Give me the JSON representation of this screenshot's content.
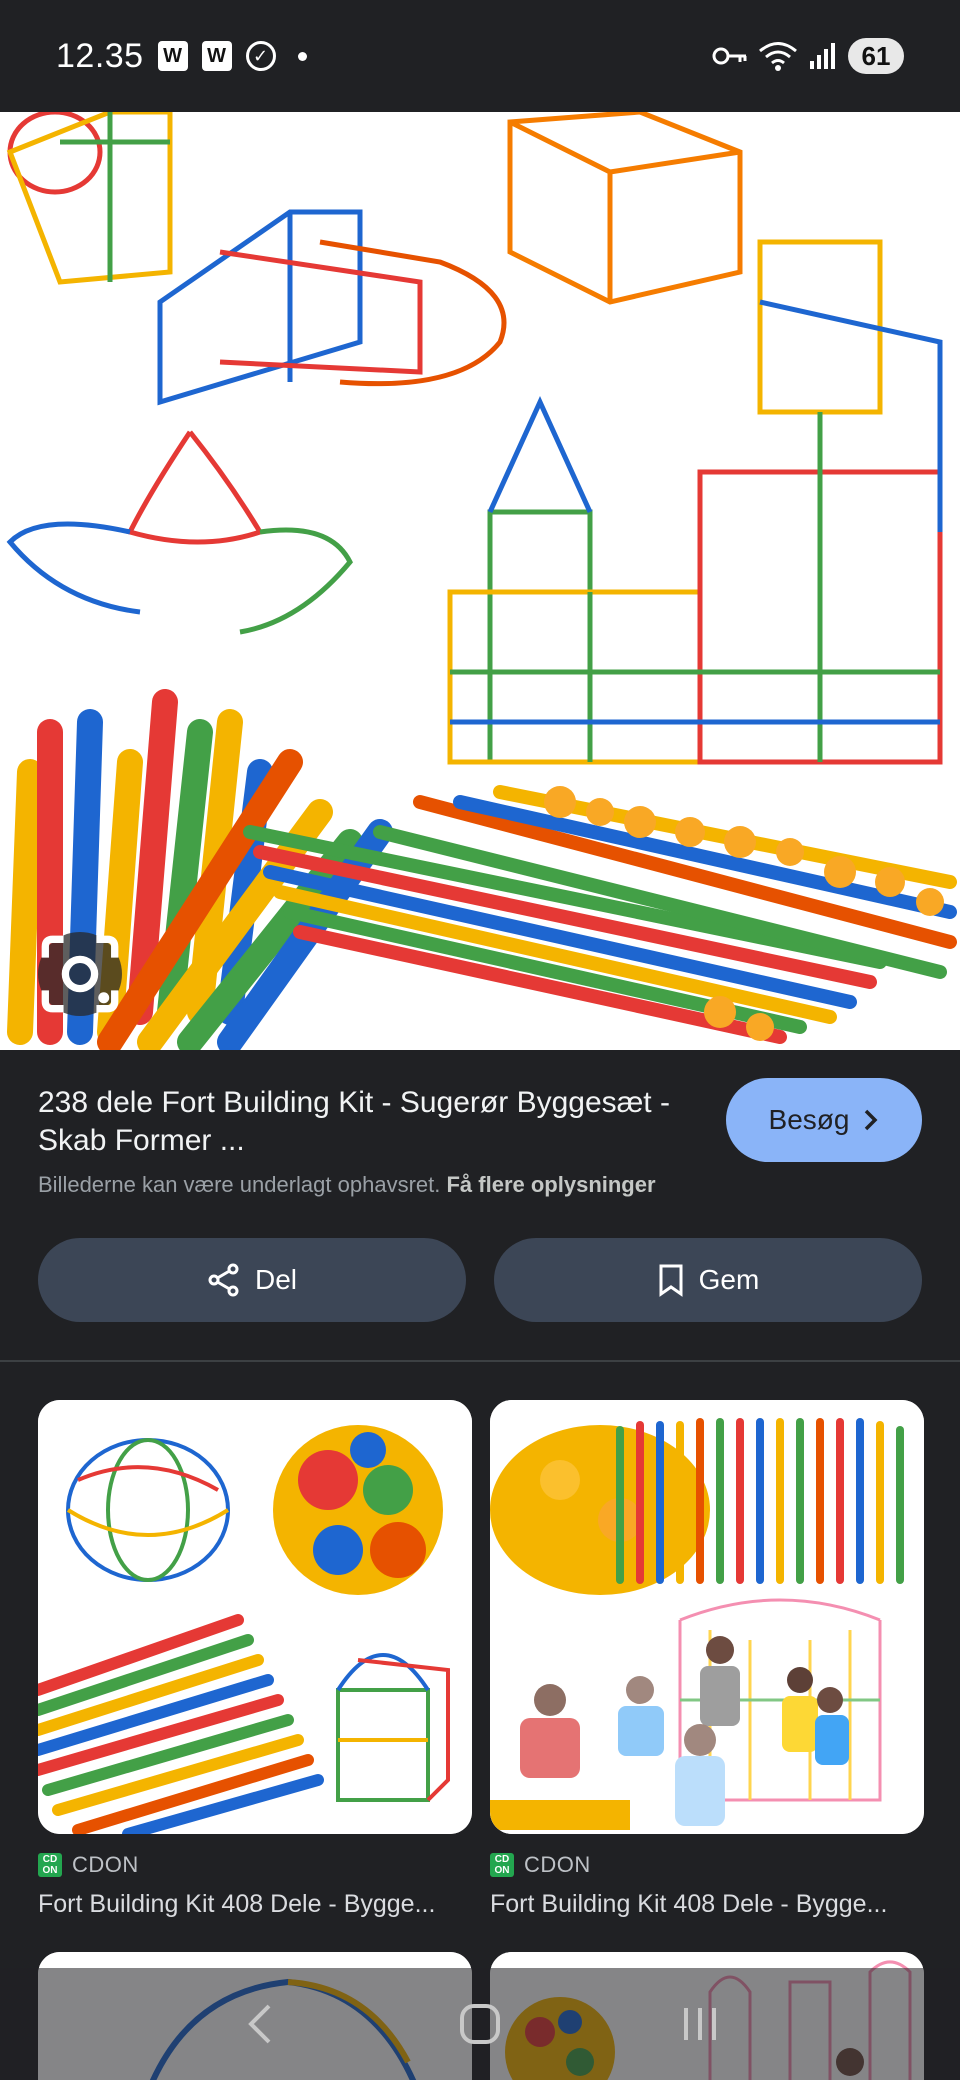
{
  "status_bar": {
    "time": "12.35",
    "notif_badge_1": "W",
    "notif_badge_2": "W",
    "battery": "61"
  },
  "hero": {
    "alt_icon": "lens-search-icon"
  },
  "result": {
    "title": "238 dele Fort Building Kit - Sugerør Byggesæt - Skab Former ...",
    "visit_label": "Besøg",
    "copyright_text": "Billederne kan være underlagt ophavsret.",
    "copyright_link": "Få flere oplysninger"
  },
  "actions": {
    "share_label": "Del",
    "save_label": "Gem"
  },
  "grid": [
    {
      "source": "CDON",
      "title": "Fort Building Kit 408 Dele - Bygge..."
    },
    {
      "source": "CDON",
      "title": "Fort Building Kit 408 Dele - Bygge..."
    }
  ],
  "colors": {
    "background": "#202124",
    "accent_button": "#8ab4f8",
    "action_button": "#3c4656",
    "cdon_green": "#23a64f"
  }
}
